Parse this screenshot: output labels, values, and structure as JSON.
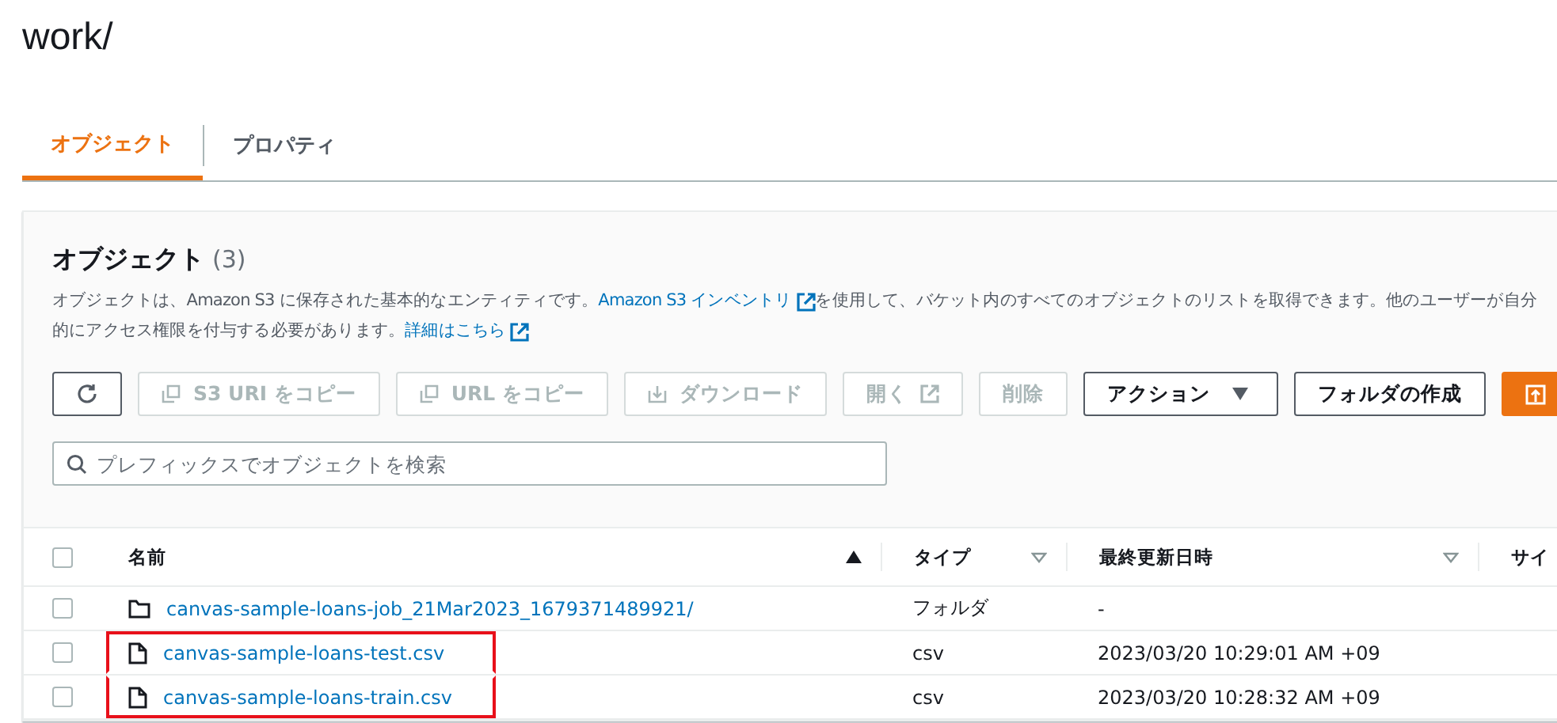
{
  "page_title": "work/",
  "tabs": [
    {
      "label": "オブジェクト",
      "selected": true
    },
    {
      "label": "プロパティ",
      "selected": false
    }
  ],
  "panel": {
    "title": "オブジェクト",
    "count": "(3)",
    "description_lines": [
      [
        {
          "kind": "text",
          "text": "オブジェクトは、Amazon S3 に保存された基本的なエンティティです。"
        },
        {
          "kind": "external_link",
          "text": "Amazon S3 インベントリ"
        },
        {
          "kind": "text",
          "text": "を使用して、バケット内のすべてのオブジェクトのリストを取得できます。他のユーザーが自分"
        }
      ],
      [
        {
          "kind": "text",
          "text": "的にアクセス権限を付与する必要があります。"
        },
        {
          "kind": "external_link",
          "text": "詳細はこちら"
        }
      ]
    ],
    "toolbar": [
      {
        "kind": "refresh",
        "disabled": false
      },
      {
        "kind": "copy",
        "label": "S3 URI をコピー",
        "disabled": true
      },
      {
        "kind": "copy",
        "label": "URL をコピー",
        "disabled": true
      },
      {
        "kind": "download",
        "label": "ダウンロード",
        "disabled": true
      },
      {
        "kind": "open",
        "label": "開く",
        "disabled": true
      },
      {
        "kind": "plain",
        "label": "削除",
        "disabled": true
      },
      {
        "kind": "dropdown",
        "label": "アクション",
        "disabled": false
      },
      {
        "kind": "plain",
        "label": "フォルダの作成",
        "disabled": false
      },
      {
        "kind": "upload",
        "disabled": false
      }
    ],
    "search": {
      "placeholder": "プレフィックスでオブジェクトを検索"
    },
    "table": {
      "select_all": {
        "checked": false
      },
      "columns": [
        {
          "label": "名前",
          "sorted": true
        },
        {
          "label": "タイプ",
          "sorted": false
        },
        {
          "label": "最終更新日時",
          "sorted": false
        },
        {
          "label": "サイ"
        }
      ],
      "rows": [
        {
          "kind": "folder",
          "name": "canvas-sample-loans-job_21Mar2023_1679371489921/",
          "type": "フォルダ",
          "modified": "-",
          "checked": false,
          "highlighted": false
        },
        {
          "kind": "file",
          "name": "canvas-sample-loans-test.csv",
          "type": "csv",
          "modified": "2023/03/20 10:29:01 AM +09",
          "checked": false,
          "highlighted": true
        },
        {
          "kind": "file",
          "name": "canvas-sample-loans-train.csv",
          "type": "csv",
          "modified": "2023/03/20 10:28:32 AM +09",
          "checked": false,
          "highlighted": true
        }
      ]
    }
  }
}
